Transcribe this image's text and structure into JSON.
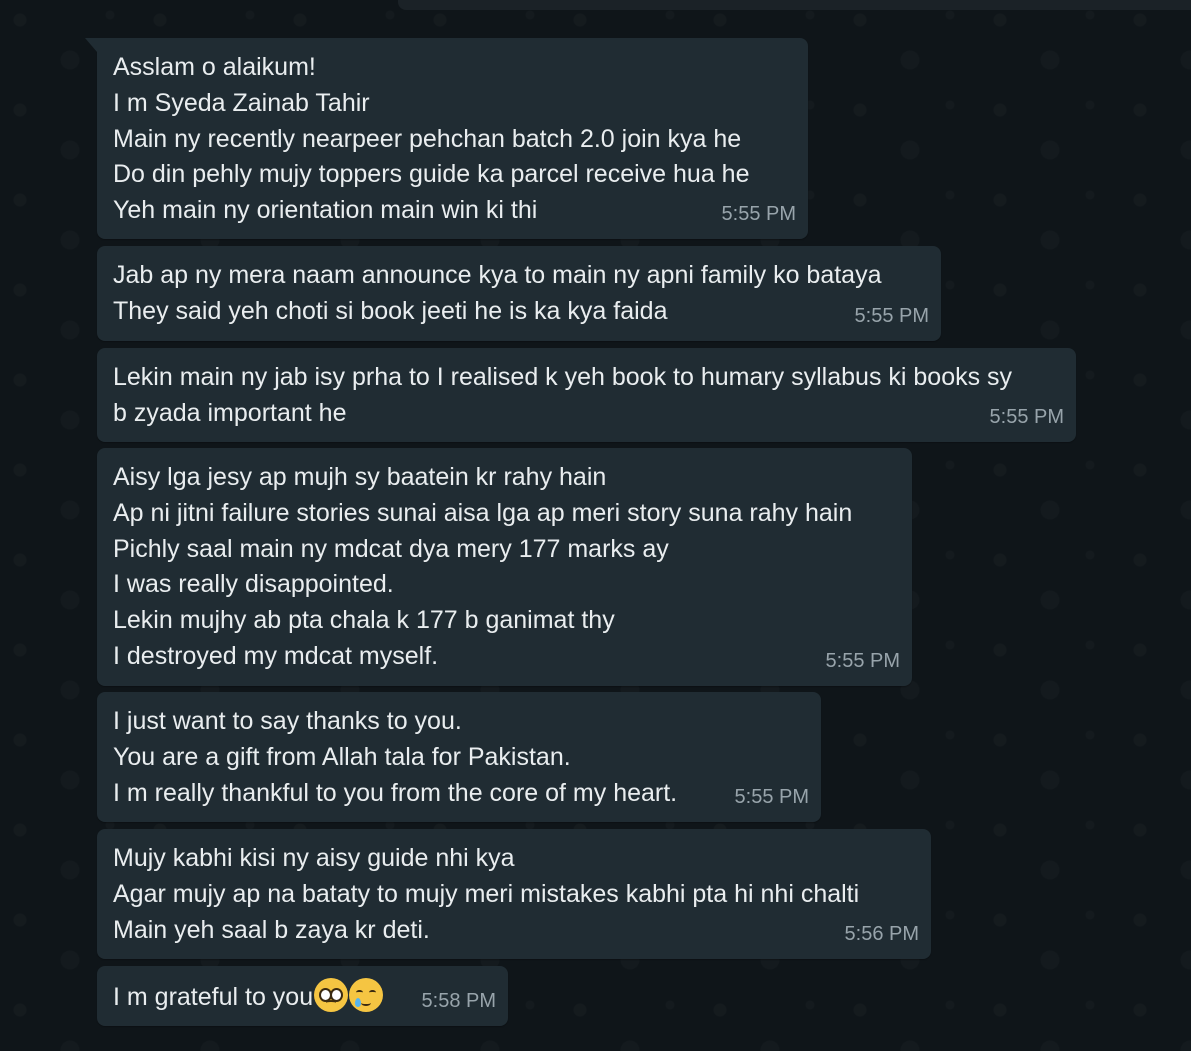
{
  "messages": [
    {
      "lines": [
        "Asslam o alaikum!",
        "I m Syeda Zainab Tahir",
        "Main ny recently nearpeer pehchan batch 2.0 join kya he",
        "Do din pehly mujy toppers guide ka parcel receive hua he",
        "Yeh main ny orientation main win ki thi"
      ],
      "time": "5:55 PM"
    },
    {
      "lines": [
        "Jab ap ny mera naam announce kya to main ny apni family ko bataya",
        "They said yeh choti si book jeeti he is ka kya faida"
      ],
      "time": "5:55 PM"
    },
    {
      "lines": [
        "Lekin main ny jab isy prha to I realised k yeh book to humary syllabus ki books sy",
        "b zyada important he"
      ],
      "time": "5:55 PM"
    },
    {
      "lines": [
        "Aisy lga jesy ap mujh sy baatein kr rahy hain",
        "Ap ni jitni failure stories sunai aisa lga ap meri story suna rahy hain",
        "Pichly saal main ny mdcat dya mery 177 marks ay",
        "I was really disappointed.",
        "Lekin mujhy ab pta chala k 177 b ganimat thy",
        "I destroyed my mdcat myself."
      ],
      "time": "5:55 PM"
    },
    {
      "lines": [
        "I just want to say thanks to you.",
        "You are a gift from Allah tala for Pakistan.",
        "I m really thankful to you from the core of my heart."
      ],
      "time": "5:55 PM"
    },
    {
      "lines": [
        "Mujy kabhi kisi ny aisy guide nhi kya",
        "Agar mujy ap na bataty to mujy meri mistakes kabhi pta hi nhi chalti",
        "Main yeh saal b zaya kr deti."
      ],
      "time": "5:56 PM"
    },
    {
      "lines": [
        "I m grateful to you"
      ],
      "emojis": [
        "pleading-face-emoji",
        "smiling-face-with-tear-emoji"
      ],
      "time": "5:58 PM"
    }
  ],
  "colors": {
    "background": "#0f1519",
    "bubble": "#202c33",
    "text": "#e9edef",
    "timestamp": "#aebac1"
  }
}
